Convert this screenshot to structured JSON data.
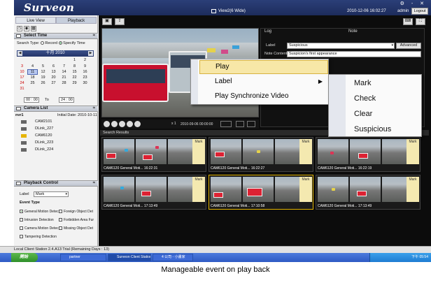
{
  "app": {
    "logo": "Surveon",
    "view_title": "View2(6 Wide)",
    "datetime": "2010-12-06 16:02:27",
    "user": "admin",
    "logout_label": "Logout",
    "window_controls": "⚙ - ✕"
  },
  "left": {
    "tabs": [
      "Live View",
      "Playback"
    ],
    "select_time": {
      "header": "Select Time",
      "search_type_label": "Search Type:",
      "options": [
        "Record",
        "Specify Time"
      ],
      "selected": "Specify Time",
      "month_label": "十月 2010",
      "weekday_row": [
        "",
        "",
        "",
        "",
        "",
        "1",
        "2"
      ],
      "weeks": [
        [
          "3",
          "4",
          "5",
          "6",
          "7",
          "8",
          "9"
        ],
        [
          "10",
          "11",
          "12",
          "13",
          "14",
          "15",
          "16"
        ],
        [
          "17",
          "18",
          "19",
          "20",
          "21",
          "22",
          "23"
        ],
        [
          "24",
          "25",
          "26",
          "27",
          "28",
          "29",
          "30"
        ],
        [
          "31",
          "",
          "",
          "",
          "",
          "",
          ""
        ]
      ],
      "highlighted_day": "11",
      "time_from": "00 : 00",
      "to_label": "To",
      "time_to": "24 : 00"
    },
    "camera_list": {
      "header": "Camera List",
      "group": "nvr1",
      "initial_date": "Initial Date: 2010-10-11",
      "cameras": [
        "CAM2101",
        "DLink_227",
        "CAM6120",
        "DLink_223",
        "DLink_224"
      ],
      "selected": "CAM6120"
    },
    "playback_control": {
      "header": "Playback Control",
      "label_label": "Label",
      "label_value": "Mark",
      "event_type_label": "Event Type",
      "events": [
        [
          "General Motion Detec",
          "Foreign Object Det"
        ],
        [
          "Intrusion Detection",
          "Forbidden Area Fur"
        ],
        [
          "Camera Motion Detec",
          "Missing Object Det"
        ],
        [
          "Tampering Detection",
          ""
        ]
      ],
      "checked": [
        "General Motion Detec"
      ]
    }
  },
  "log": {
    "tabs": [
      "Log",
      "Note"
    ],
    "label_label": "Label",
    "label_value": "Suspicious",
    "advanced_label": "Advanced",
    "note_label": "Note Content",
    "note_value": "Suspicion's first appearance"
  },
  "video": {
    "speed": "x 1",
    "time": "2010-09-06 00:00:00"
  },
  "search_results": {
    "header": "Search Results",
    "mark_label": "Mark",
    "items": [
      {
        "cam": "CAM6120",
        "event": "General Moti...",
        "time": "16:22:31"
      },
      {
        "cam": "CAM6120",
        "event": "General Moti...",
        "time": "16:22:27"
      },
      {
        "cam": "CAM6120",
        "event": "General Moti...",
        "time": "16:22:19"
      },
      {
        "cam": "CAM6120",
        "event": "General Moti...",
        "time": "17:13:49"
      },
      {
        "cam": "CAM6120",
        "event": "General Moti...",
        "time": "17:10:58"
      },
      {
        "cam": "CAM6120",
        "event": "General Moti...",
        "time": "17:13:49"
      }
    ]
  },
  "context_menu": {
    "items": [
      "Play",
      "Label",
      "Play Synchronize Video"
    ],
    "submenu": [
      "Mark",
      "Check",
      "Clear",
      "Suspicious"
    ]
  },
  "statusbar": {
    "text": "Local Client Station 2.4.A13 Trial (Remaining Days : 13)"
  },
  "taskbar": {
    "start": "開始",
    "items": [
      "partner",
      "Surveon Client Station",
      "4 公司 - 小畫家"
    ],
    "clock": "下午 05:54"
  },
  "caption": "Manageable event on play back",
  "colors": {
    "titlebar": "#2b3f78",
    "menu_highlight": "#f7e7a7",
    "selected_thumb_border": "#e2b400"
  }
}
